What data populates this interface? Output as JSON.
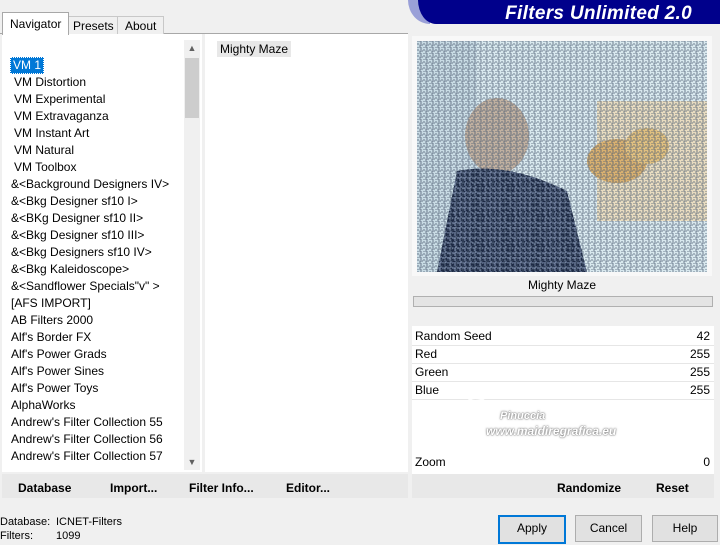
{
  "tabs": [
    {
      "label": "Navigator"
    },
    {
      "label": "Presets"
    },
    {
      "label": "About"
    }
  ],
  "banner": {
    "title": "Filters Unlimited 2.0"
  },
  "categories": [
    "VM 1",
    "VM Distortion",
    "VM Experimental",
    "VM Extravaganza",
    "VM Instant Art",
    "VM Natural",
    "VM Toolbox",
    "&<Background Designers IV>",
    "&<Bkg Designer sf10 I>",
    "&<BKg Designer sf10 II>",
    "&<Bkg Designer sf10 III>",
    "&<Bkg Designers sf10 IV>",
    "&<Bkg Kaleidoscope>",
    "&<Sandflower Specials\"v\" >",
    "[AFS IMPORT]",
    "AB Filters 2000",
    "Alf's Border FX",
    "Alf's Power Grads",
    "Alf's Power Sines",
    "Alf's Power Toys",
    "AlphaWorks",
    "Andrew's Filter Collection 55",
    "Andrew's Filter Collection 56",
    "Andrew's Filter Collection 57"
  ],
  "selected_filter": "Mighty Maze",
  "preview_label": "Mighty Maze",
  "params": [
    {
      "label": "Random Seed",
      "value": "42"
    },
    {
      "label": "Red",
      "value": "255"
    },
    {
      "label": "Green",
      "value": "255"
    },
    {
      "label": "Blue",
      "value": "255"
    }
  ],
  "zoom": {
    "label": "Zoom",
    "value": "0"
  },
  "left_buttons": {
    "database": "Database",
    "import": "Import...",
    "filter_info": "Filter Info...",
    "editor": "Editor..."
  },
  "right_buttons": {
    "randomize": "Randomize",
    "reset": "Reset"
  },
  "status": {
    "database_label": "Database:",
    "database_value": "ICNET-Filters",
    "filters_label": "Filters:",
    "filters_value": "1099"
  },
  "dialog_buttons": {
    "apply": "Apply",
    "cancel": "Cancel",
    "help": "Help"
  },
  "watermark": {
    "line1": "Pinuccia",
    "line2": "www.maidiregrafica.eu"
  },
  "icons": {
    "scroll_up": "scroll-up-icon",
    "scroll_down": "scroll-down-icon"
  }
}
